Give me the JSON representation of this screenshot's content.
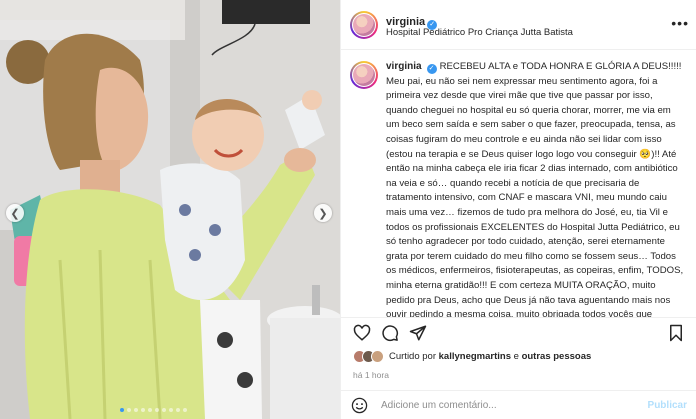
{
  "post": {
    "username": "virginia",
    "location": "Hospital Pediátrico Pro Criança Jutta Batista",
    "caption_username": "virginia",
    "caption": "RECEBEU ALTA e TODA HONRA E GLÓRIA A DEUS!!!!! Meu pai, eu não sei nem expressar meu sentimento agora, foi a primeira vez desde que virei mãe que tive que passar por isso, quando cheguei no hospital eu só queria chorar, morrer, me via em um beco sem saída e sem saber o que fazer, preocupada, tensa, as coisas fugiram do meu controle e eu ainda não sei lidar com isso (estou na terapia e se Deus quiser logo logo vou conseguir 🥺)!! Até então na minha cabeça ele iria ficar 2 dias internado, com antibiótico na veia e só… quando recebi a notícia de que precisaria de tratamento intensivo, com CNAF e mascara VNI, meu mundo caiu mais uma vez… fizemos de tudo pra melhora do José, eu, tia Vil e todos os profissionais EXCELENTES do Hospital Jutta Pediátrico, eu só tenho agradecer por todo cuidado, atenção, serei eternamente grata por terem cuidado do meu filho como se fossem seus… Todos os médicos, enfermeiros, fisioterapeutas, as copeiras, enfim, TODOS, minha eterna gratidão!!! E com certeza MUITA ORAÇÃO, muito pedido pra Deus, acho que Deus já não tava aguentando mais nos ouvir pedindo a mesma coisa, muito obrigada todos vocês que ficaram",
    "liked_by_prefix": "Curtido por",
    "liked_by_user": "kallynegmartins",
    "liked_by_connector": "e",
    "liked_by_others": "outras pessoas",
    "time": "há 1 hora",
    "comment_placeholder": "Adicione um comentário...",
    "publish_label": "Publicar"
  },
  "icons": {
    "more": "more-options-icon",
    "like": "heart-icon",
    "comment": "comment-icon",
    "share": "share-icon",
    "save": "bookmark-icon",
    "emoji": "emoji-icon",
    "prev": "chevron-left-icon",
    "next": "chevron-right-icon"
  },
  "carousel": {
    "slide_count": 10,
    "active_slide": 0
  },
  "colors": {
    "verified": "#3897f0",
    "publish_disabled": "#b2dffc",
    "sweater": "#d8e58a"
  }
}
